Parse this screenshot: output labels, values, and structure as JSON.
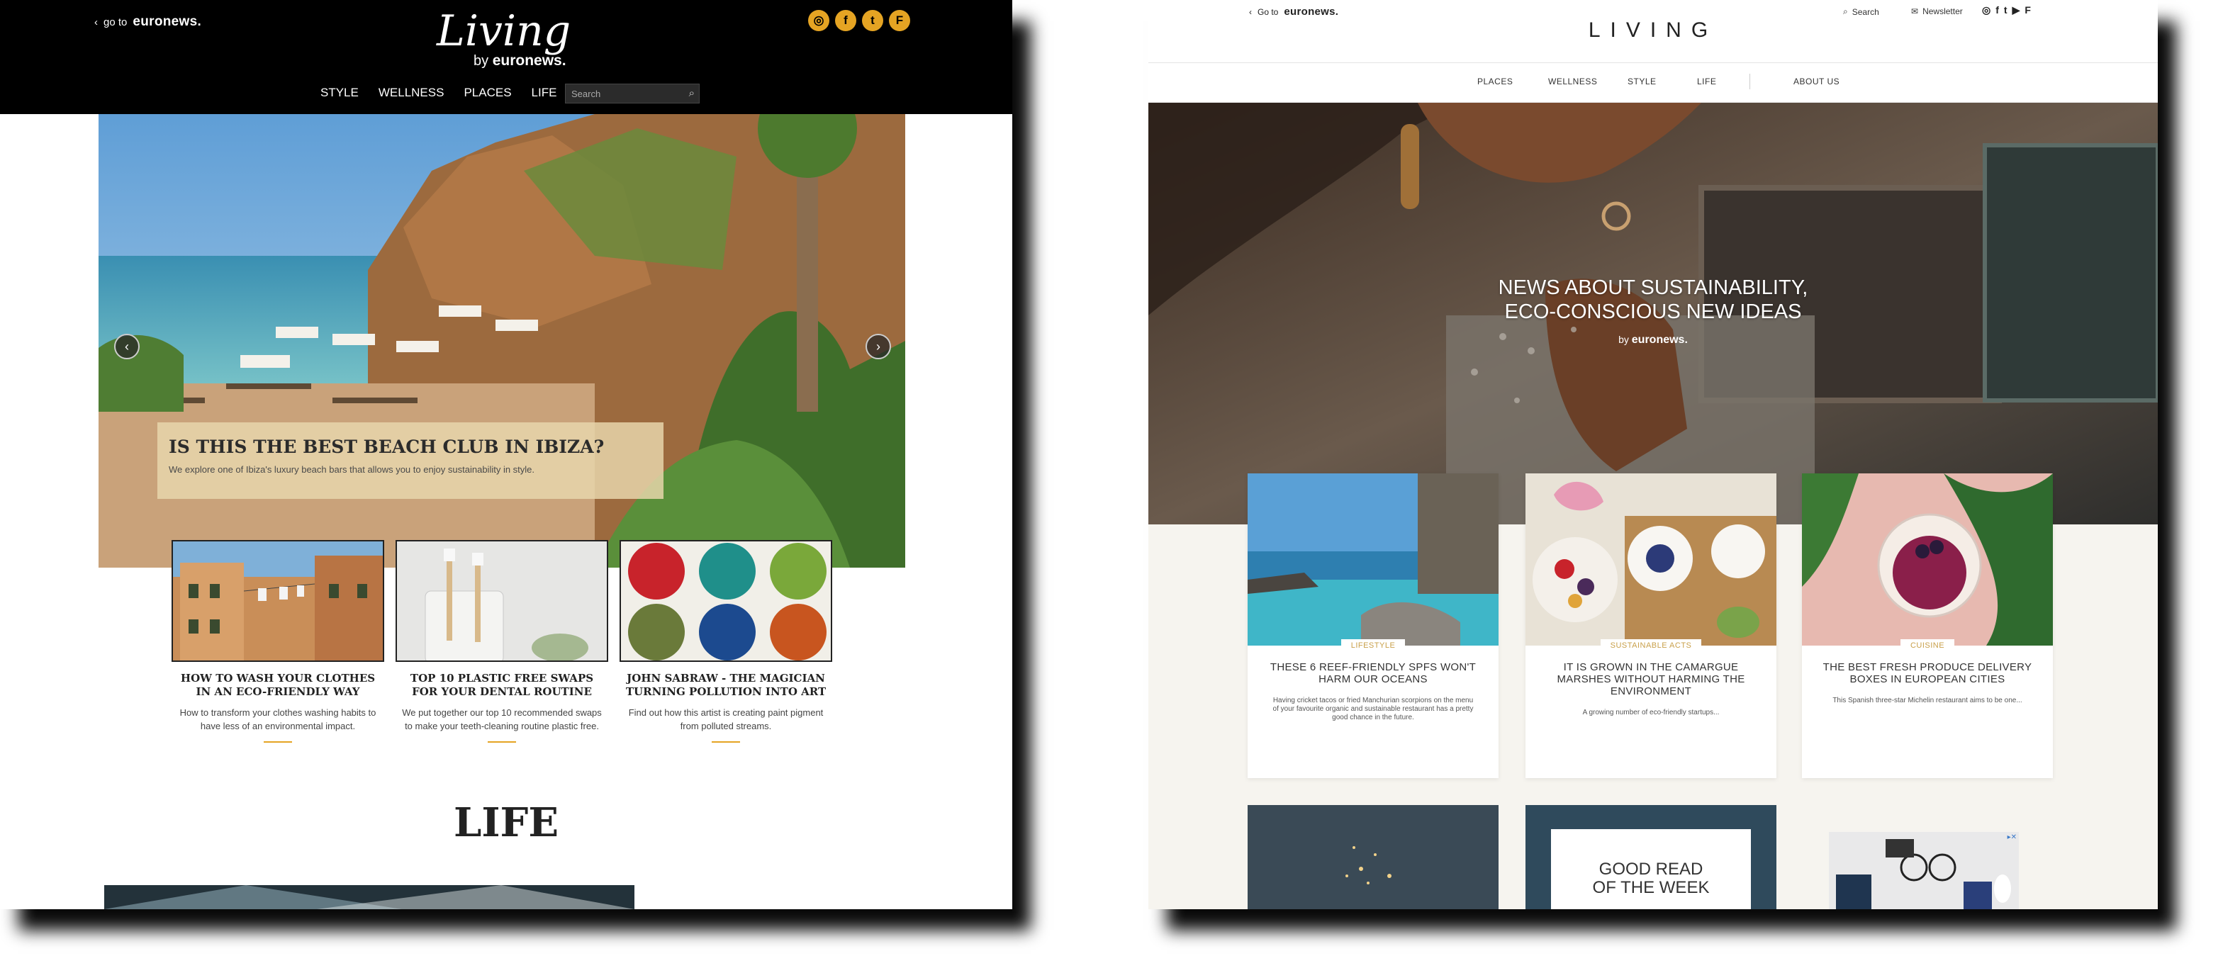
{
  "left_page": {
    "header": {
      "back_label": "go to",
      "brand": "euronews.",
      "logo": "Living",
      "logo_by": "by",
      "logo_brand": "euronews.",
      "social_icons": [
        "instagram-icon",
        "facebook-icon",
        "twitter-icon",
        "flipboard-icon"
      ],
      "social_glyphs": [
        "◎",
        "f",
        "t",
        "F"
      ]
    },
    "nav": {
      "items": [
        "STYLE",
        "WELLNESS",
        "PLACES",
        "LIFE"
      ],
      "search_placeholder": "Search"
    },
    "hero": {
      "title": "IS THIS THE BEST BEACH CLUB IN IBIZA?",
      "subtitle": "We explore one of Ibiza's luxury beach bars that allows you to enjoy sustainability in style."
    },
    "cards": [
      {
        "title": "HOW TO WASH YOUR CLOTHES IN AN ECO-FRIENDLY WAY",
        "text": "How to transform your clothes washing habits to have less of an environmental impact."
      },
      {
        "title": "TOP 10 PLASTIC FREE SWAPS FOR YOUR DENTAL ROUTINE",
        "text": "We put together our top 10 recommended swaps to make your teeth-cleaning routine plastic free."
      },
      {
        "title": "JOHN SABRAW - THE MAGICIAN TURNING POLLUTION INTO ART",
        "text": "Find out how this artist is creating paint pigment from polluted streams."
      }
    ],
    "section_title": "LIFE"
  },
  "right_page": {
    "header": {
      "back_label": "Go to",
      "brand": "euronews.",
      "logo": "LIVING",
      "search_label": "Search",
      "newsletter_label": "Newsletter",
      "social_icons": [
        "instagram-icon",
        "facebook-icon",
        "twitter-icon",
        "youtube-icon",
        "flipboard-icon"
      ],
      "social_glyphs": [
        "◎",
        "f",
        "t",
        "▶",
        "F"
      ]
    },
    "nav": {
      "items": [
        "PLACES",
        "WELLNESS",
        "STYLE",
        "LIFE"
      ],
      "about": "ABOUT US"
    },
    "hero": {
      "line1": "NEWS ABOUT SUSTAINABILITY,",
      "line2": "ECO-CONSCIOUS NEW IDEAS",
      "by": "by",
      "brand": "euronews."
    },
    "cards": [
      {
        "category": "LIFESTYLE",
        "title": "THESE 6 REEF-FRIENDLY SPFS WON'T HARM OUR OCEANS",
        "text": "Having cricket tacos or fried Manchurian scorpions on the menu of your favourite organic and sustainable restaurant has a pretty good chance in the future."
      },
      {
        "category": "SUSTAINABLE ACTS",
        "title": "IT IS GROWN IN THE CAMARGUE MARSHES WITHOUT HARMING THE ENVIRONMENT",
        "text": "A growing number of eco-friendly startups..."
      },
      {
        "category": "CUISINE",
        "title": "THE BEST FRESH PRODUCE DELIVERY BOXES IN EUROPEAN CITIES",
        "text": "This Spanish three-star Michelin restaurant aims to be one..."
      }
    ],
    "good_read": {
      "line1": "GOOD READ",
      "line2": "OF THE WEEK"
    }
  }
}
